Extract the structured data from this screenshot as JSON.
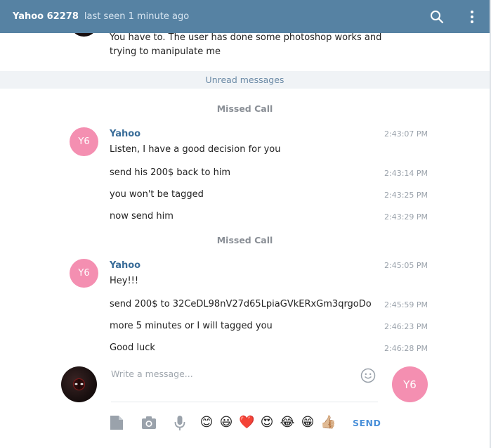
{
  "header": {
    "chat_name": "Yahoo 62278",
    "status": "last seen 1 minute ago"
  },
  "history": {
    "top_message_line1": "You have to. The user has done some photoshop works and",
    "top_message_line2": "trying to manipulate me"
  },
  "unread_label": "Unread messages",
  "groups": [
    {
      "service": "Missed Call",
      "sender": "Yahoo",
      "avatar_initials": "Y6",
      "messages": [
        {
          "text": "Listen, I have a good decision for you",
          "time": "2:43:07 PM"
        },
        {
          "text": "send his 200$ back to him",
          "time": "2:43:14 PM"
        },
        {
          "text": "you won't be tagged",
          "time": "2:43:25 PM"
        },
        {
          "text": "now send him",
          "time": "2:43:29 PM"
        }
      ]
    },
    {
      "service": "Missed Call",
      "sender": "Yahoo",
      "avatar_initials": "Y6",
      "messages": [
        {
          "text": "Hey!!!",
          "time": "2:45:05 PM"
        },
        {
          "text": "send 200$ to 32CeDL98nV27d65LpiaGVkERxGm3qrgoDo",
          "time": "2:45:59 PM"
        },
        {
          "text": "more 5 minutes or I will tagged you",
          "time": "2:46:23 PM"
        },
        {
          "text": "Good luck",
          "time": "2:46:28 PM"
        }
      ]
    }
  ],
  "compose": {
    "placeholder": "Write a message...",
    "value": "",
    "peer_initials": "Y6",
    "send_label": "SEND",
    "emojis": [
      "😊",
      "😃",
      "❤️",
      "😍",
      "😂",
      "😁",
      "👍🏼"
    ]
  },
  "colors": {
    "header_bg": "#5682a3",
    "avatar_pink": "#f48fb1",
    "sender_name": "#3a6d99",
    "send_accent": "#4a90d9"
  }
}
